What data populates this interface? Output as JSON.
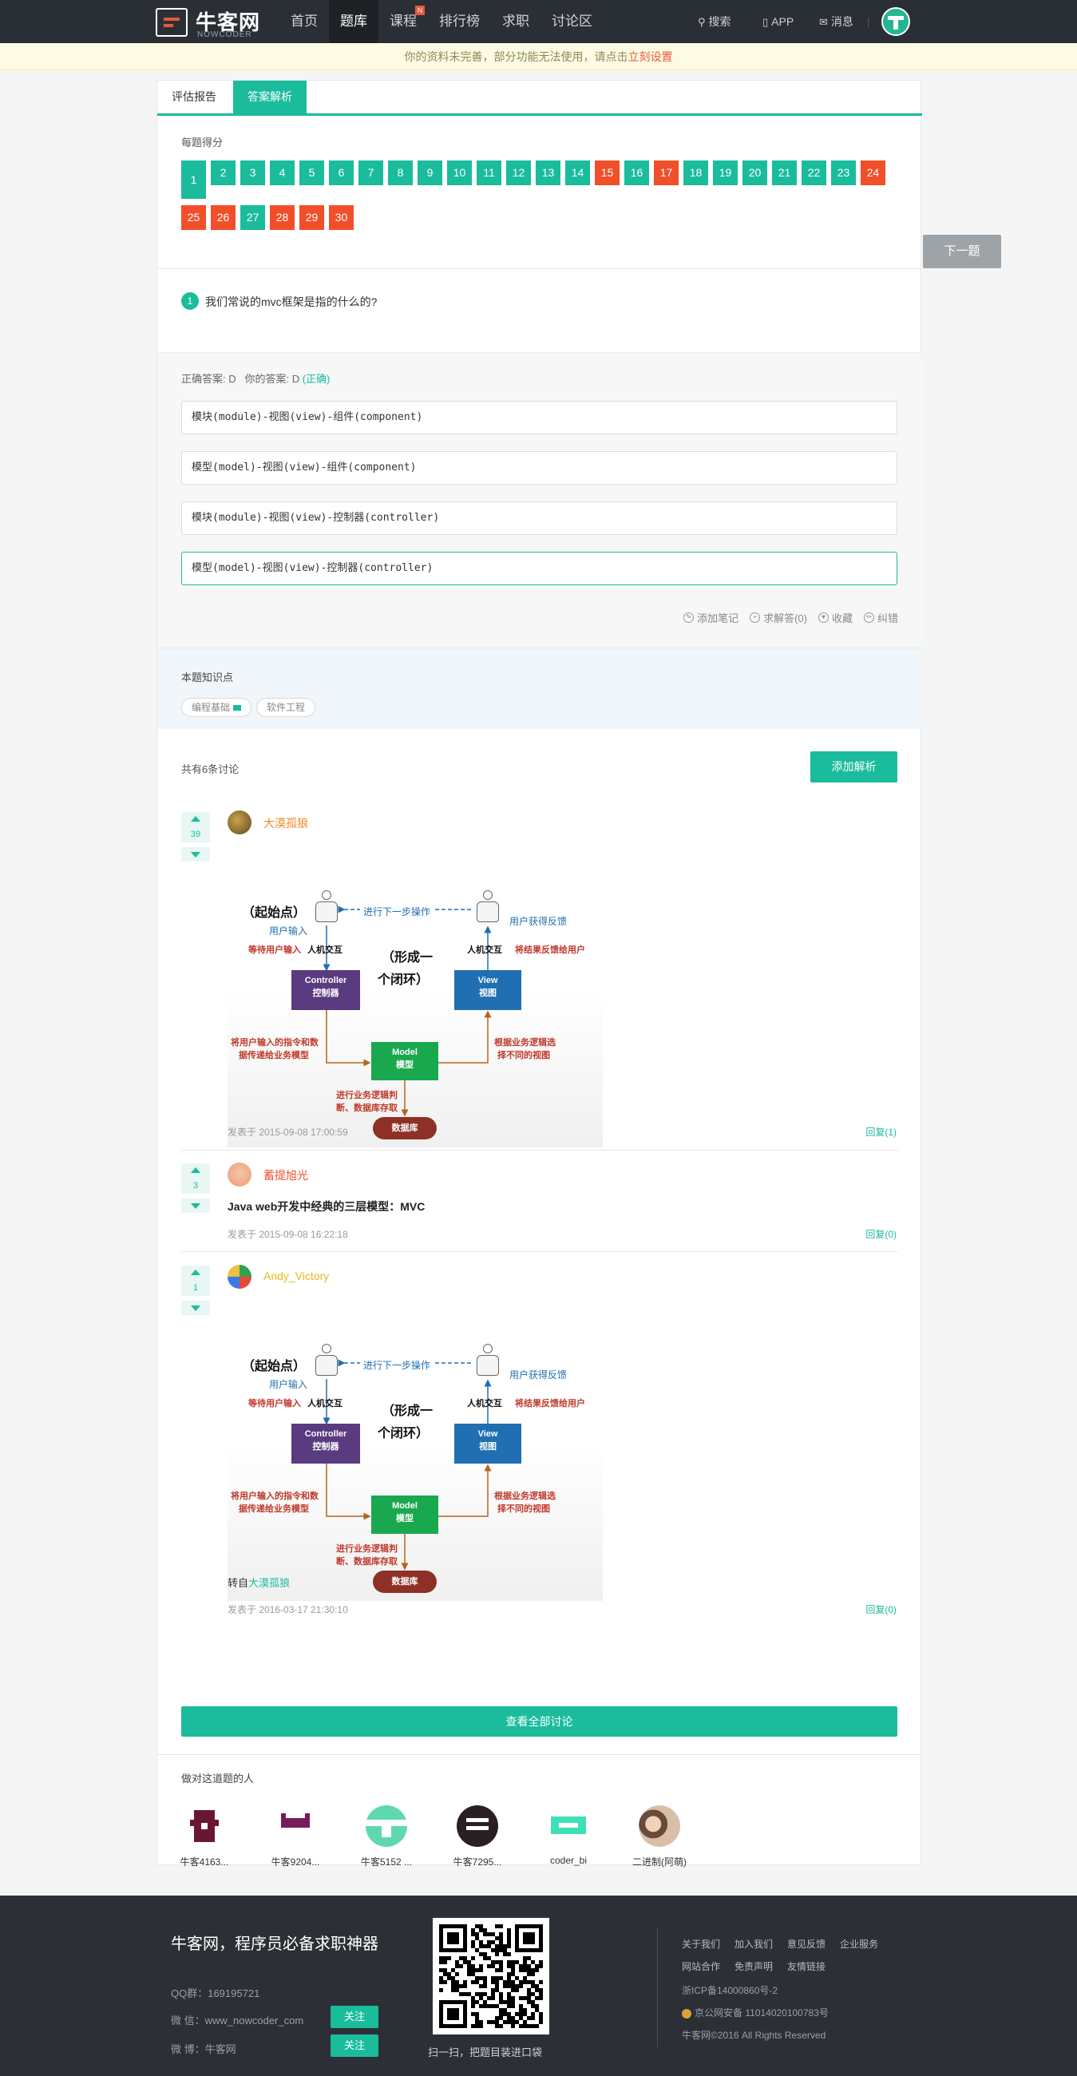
{
  "header": {
    "logo_text": "牛客网",
    "logo_sub": "NOWCODER",
    "nav": [
      {
        "label": "首页",
        "active": false
      },
      {
        "label": "题库",
        "active": true
      },
      {
        "label": "课程",
        "active": false,
        "badge": "N"
      },
      {
        "label": "排行榜",
        "active": false
      },
      {
        "label": "求职",
        "active": false
      },
      {
        "label": "讨论区",
        "active": false
      }
    ],
    "search_label": "搜索",
    "app_label": "APP",
    "msg_label": "消息"
  },
  "notice": {
    "text": "你的资料未完善，部分功能无法使用，请点击",
    "link": "立刻设置"
  },
  "tabs": [
    "评估报告",
    "答案解析"
  ],
  "scores": {
    "label": "每题得分",
    "current": 1,
    "items": [
      {
        "n": "1",
        "s": "g"
      },
      {
        "n": "2",
        "s": "g"
      },
      {
        "n": "3",
        "s": "g"
      },
      {
        "n": "4",
        "s": "g"
      },
      {
        "n": "5",
        "s": "g"
      },
      {
        "n": "6",
        "s": "g"
      },
      {
        "n": "7",
        "s": "g"
      },
      {
        "n": "8",
        "s": "g"
      },
      {
        "n": "9",
        "s": "g"
      },
      {
        "n": "10",
        "s": "g"
      },
      {
        "n": "11",
        "s": "g"
      },
      {
        "n": "12",
        "s": "g"
      },
      {
        "n": "13",
        "s": "g"
      },
      {
        "n": "14",
        "s": "g"
      },
      {
        "n": "15",
        "s": "r"
      },
      {
        "n": "16",
        "s": "g"
      },
      {
        "n": "17",
        "s": "r"
      },
      {
        "n": "18",
        "s": "g"
      },
      {
        "n": "19",
        "s": "g"
      },
      {
        "n": "20",
        "s": "g"
      },
      {
        "n": "21",
        "s": "g"
      },
      {
        "n": "22",
        "s": "g"
      },
      {
        "n": "23",
        "s": "g"
      },
      {
        "n": "24",
        "s": "r"
      },
      {
        "n": "25",
        "s": "r"
      },
      {
        "n": "26",
        "s": "r"
      },
      {
        "n": "27",
        "s": "g"
      },
      {
        "n": "28",
        "s": "r"
      },
      {
        "n": "29",
        "s": "r"
      },
      {
        "n": "30",
        "s": "r"
      }
    ],
    "colors": {
      "correct": "#1abc9c",
      "wrong": "#f14f2a"
    }
  },
  "next_button": "下一题",
  "question": {
    "num": "1",
    "text": "我们常说的mvc框架是指的什么的?"
  },
  "answer": {
    "correct_label": "正确答案: D",
    "yours_label": "你的答案: D",
    "result": "(正确)",
    "options": [
      {
        "text": "模块(module)-视图(view)-组件(component)",
        "correct": false
      },
      {
        "text": "模型(model)-视图(view)-组件(component)",
        "correct": false
      },
      {
        "text": "模块(module)-视图(view)-控制器(controller)",
        "correct": false
      },
      {
        "text": "模型(model)-视图(view)-控制器(controller)",
        "correct": true
      }
    ],
    "actions": [
      "添加笔记",
      "求解答(0)",
      "收藏",
      "纠错"
    ]
  },
  "knowledge": {
    "title": "本题知识点",
    "tags": [
      "编程基础",
      "软件工程"
    ]
  },
  "discussion": {
    "count_label": "共有6条讨论",
    "add_button": "添加解析",
    "diagram": {
      "start": "（起始点）",
      "next_op": "进行下一步操作",
      "user_input": "用户输入",
      "user_feedback": "用户获得反馈",
      "hci": "人机交互",
      "wait_input": "等待用户输入",
      "feedback_user": "将结果反馈给用户",
      "loop1": "（形成一",
      "loop2": "个闭环）",
      "controller": "Controller",
      "controller_cn": "控制器",
      "view": "View",
      "view_cn": "视图",
      "model": "Model",
      "model_cn": "模型",
      "left_note1": "将用户输入的指令和数",
      "left_note2": "据传递给业务模型",
      "right_note1": "根据业务逻辑选",
      "right_note2": "择不同的视图",
      "bottom_note1": "进行业务逻辑判",
      "bottom_note2": "断、数据库存取",
      "db": "数据库"
    },
    "posts": [
      {
        "votes": "39",
        "user": "大漠孤狼",
        "date": "发表于 2015-09-08 17:00:59",
        "reply": "回复(1)"
      },
      {
        "votes": "3",
        "user": "蓄提旭光",
        "text": "Java web开发中经典的三层模型：MVC",
        "date": "发表于 2015-09-08 16:22:18",
        "reply": "回复(0)"
      },
      {
        "votes": "1",
        "user": "Andy_Victory",
        "repost_prefix": "转自",
        "repost_user": "大漠孤狼",
        "date": "发表于 2016-03-17 21:30:10",
        "reply": "回复(0)"
      }
    ],
    "view_all": "查看全部讨论"
  },
  "did_right": {
    "title": "做对这道题的人",
    "users": [
      "牛客4163...",
      "牛客9204...",
      "牛客5152 ...",
      "牛客7295...",
      "coder_bi",
      "二进制(阿萌)"
    ]
  },
  "footer": {
    "slogan": "牛客网，程序员必备求职神器",
    "qq": "QQ群：169195721",
    "wechat": "微 信：www_nowcoder_com",
    "weibo": "微 博：牛客网",
    "follow": "关注",
    "qr_caption": "扫一扫，把题目装进口袋",
    "links": [
      "关于我们",
      "加入我们",
      "意见反馈",
      "企业服务"
    ],
    "links2": [
      "网站合作",
      "免责声明",
      "友情链接"
    ],
    "icp": "浙ICP备14000860号-2",
    "police": "京公网安备 11014020100783号",
    "copyright": "牛客网©2016 All Rights Reserved"
  }
}
